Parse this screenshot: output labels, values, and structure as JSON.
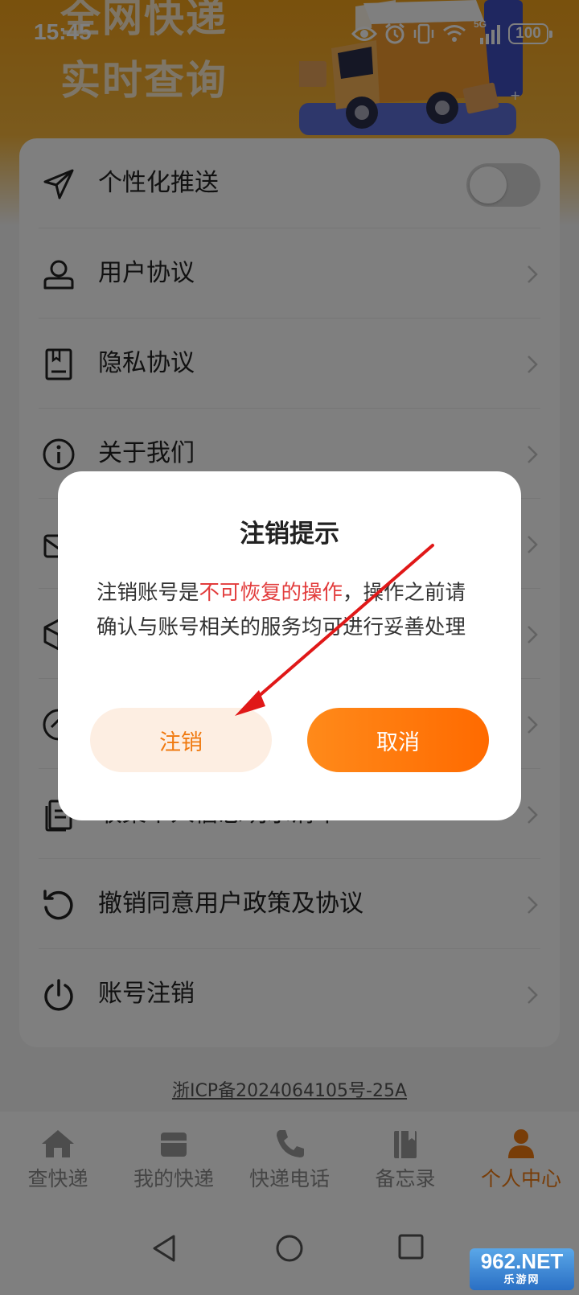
{
  "status_bar": {
    "time": "15:45",
    "network": "5G",
    "battery": "100",
    "icons": [
      "eye-icon",
      "alarm-icon",
      "vibrate-icon",
      "wifi-icon",
      "signal-icon",
      "battery-icon"
    ]
  },
  "header": {
    "line1": "全网快递",
    "line2": "实时查询"
  },
  "settings": {
    "items": [
      {
        "label": "个性化推送",
        "icon": "send-icon",
        "control": "toggle",
        "toggle_on": false
      },
      {
        "label": "用户协议",
        "icon": "user-icon",
        "control": "chevron"
      },
      {
        "label": "隐私协议",
        "icon": "document-icon",
        "control": "chevron"
      },
      {
        "label": "关于我们",
        "icon": "info-icon",
        "control": "chevron"
      },
      {
        "label": "",
        "icon": "mail-icon",
        "control": "chevron"
      },
      {
        "label": "",
        "icon": "box-icon",
        "control": "chevron"
      },
      {
        "label": "",
        "icon": "clock-icon",
        "control": "chevron"
      },
      {
        "label": "收集个人信息明示清单",
        "icon": "list-icon",
        "control": "chevron"
      },
      {
        "label": "撤销同意用户政策及协议",
        "icon": "revoke-icon",
        "control": "chevron"
      },
      {
        "label": "账号注销",
        "icon": "power-icon",
        "control": "chevron"
      }
    ]
  },
  "icp": "浙ICP备2024064105号-25A",
  "bottom_nav": {
    "items": [
      {
        "label": "查快递",
        "icon": "home-icon",
        "active": false
      },
      {
        "label": "我的快递",
        "icon": "package-icon",
        "active": false
      },
      {
        "label": "快递电话",
        "icon": "phone-icon",
        "active": false
      },
      {
        "label": "备忘录",
        "icon": "notebook-icon",
        "active": false
      },
      {
        "label": "个人中心",
        "icon": "person-icon",
        "active": true
      }
    ]
  },
  "dialog": {
    "title": "注销提示",
    "message_before": "注销账号是",
    "message_warning": "不可恢复的操作",
    "message_after": "，操作之前请确认与账号相关的服务均可进行妥善处理",
    "confirm_label": "注销",
    "cancel_label": "取消"
  },
  "watermark": {
    "main": "962.NET",
    "sub": "乐游网"
  },
  "colors": {
    "accent": "#f07a10",
    "warning": "#e23c3c",
    "header": "#f3a21a"
  }
}
